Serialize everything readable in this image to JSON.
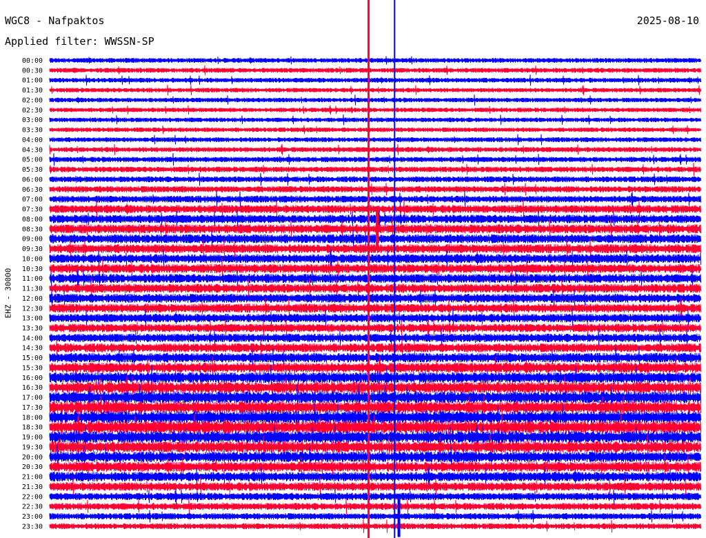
{
  "header": {
    "station": "WGC8 - Nafpaktos",
    "date": "2025-08-10",
    "filter": "Applied filter: WWSSN-SP"
  },
  "channel_label": "EHZ - 30000",
  "colors": {
    "trace_a": "#0000ff",
    "trace_b": "#ff0033",
    "background": "#ffffff"
  },
  "chart_data": {
    "type": "line",
    "subtype": "helicorder",
    "rows": [
      "00:00",
      "00:30",
      "01:00",
      "01:30",
      "02:00",
      "02:30",
      "03:00",
      "03:30",
      "04:00",
      "04:30",
      "05:00",
      "05:30",
      "06:00",
      "06:30",
      "07:00",
      "07:30",
      "08:00",
      "08:30",
      "09:00",
      "09:30",
      "10:00",
      "10:30",
      "11:00",
      "11:30",
      "12:00",
      "12:30",
      "13:00",
      "13:30",
      "14:00",
      "14:30",
      "15:00",
      "15:30",
      "16:00",
      "16:30",
      "17:00",
      "17:30",
      "18:00",
      "18:30",
      "19:00",
      "19:30",
      "20:00",
      "20:30",
      "21:00",
      "21:30",
      "22:00",
      "22:30",
      "23:00",
      "23:30"
    ],
    "row_duration_minutes": 30,
    "alternating_colors": [
      "blue",
      "red"
    ],
    "noise_level_by_row": [
      0.9,
      0.9,
      0.9,
      0.85,
      0.85,
      0.85,
      0.85,
      0.85,
      0.9,
      0.95,
      1.0,
      1.05,
      1.1,
      1.2,
      1.3,
      1.5,
      1.6,
      1.7,
      1.7,
      1.7,
      1.7,
      1.7,
      1.7,
      1.7,
      1.7,
      1.7,
      1.6,
      1.6,
      1.6,
      1.7,
      1.8,
      1.9,
      2.0,
      2.1,
      2.2,
      2.2,
      2.3,
      2.3,
      2.2,
      2.1,
      2.0,
      1.9,
      1.8,
      1.6,
      1.4,
      1.3,
      1.2,
      1.1
    ],
    "events": [
      {
        "row": "08:00",
        "minute": 14.7,
        "amplitude": "clipped",
        "color": "red"
      },
      {
        "row": "08:30",
        "minute": 15.1,
        "amplitude": "large",
        "color": "red"
      },
      {
        "row": "00:00",
        "minute": 15.9,
        "amplitude": "clipped",
        "color": "blue"
      },
      {
        "row": "23:00",
        "minute": 16.1,
        "amplitude": "large",
        "color": "blue"
      }
    ]
  }
}
